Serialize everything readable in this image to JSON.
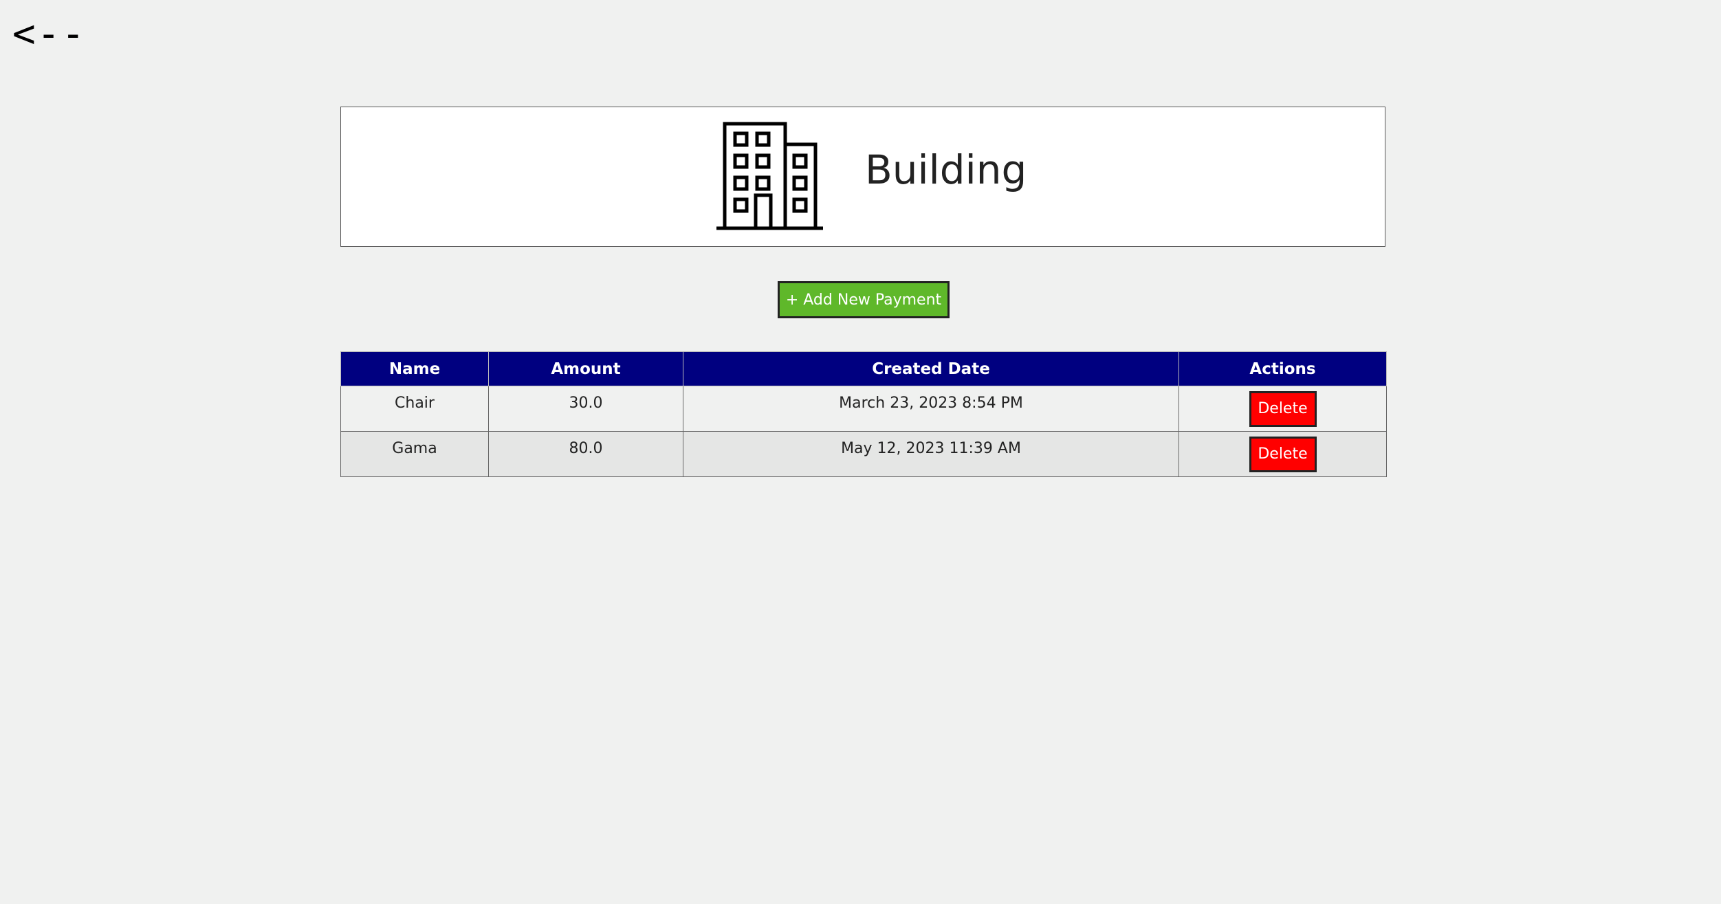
{
  "back_link": {
    "label": "<--"
  },
  "header": {
    "title": "Building",
    "icon": "building-icon"
  },
  "toolbar": {
    "add_label": "+ Add New Payment",
    "add_color": "#5fb82a"
  },
  "table": {
    "header_color": "#000080",
    "columns": [
      "Name",
      "Amount",
      "Created Date",
      "Actions"
    ],
    "rows": [
      {
        "name": "Chair",
        "amount": "30.0",
        "created": "March 23, 2023 8:54 PM",
        "action": "Delete"
      },
      {
        "name": "Gama",
        "amount": "80.0",
        "created": "May 12, 2023 11:39 AM",
        "action": "Delete"
      }
    ],
    "delete_color": "#ff0000"
  }
}
